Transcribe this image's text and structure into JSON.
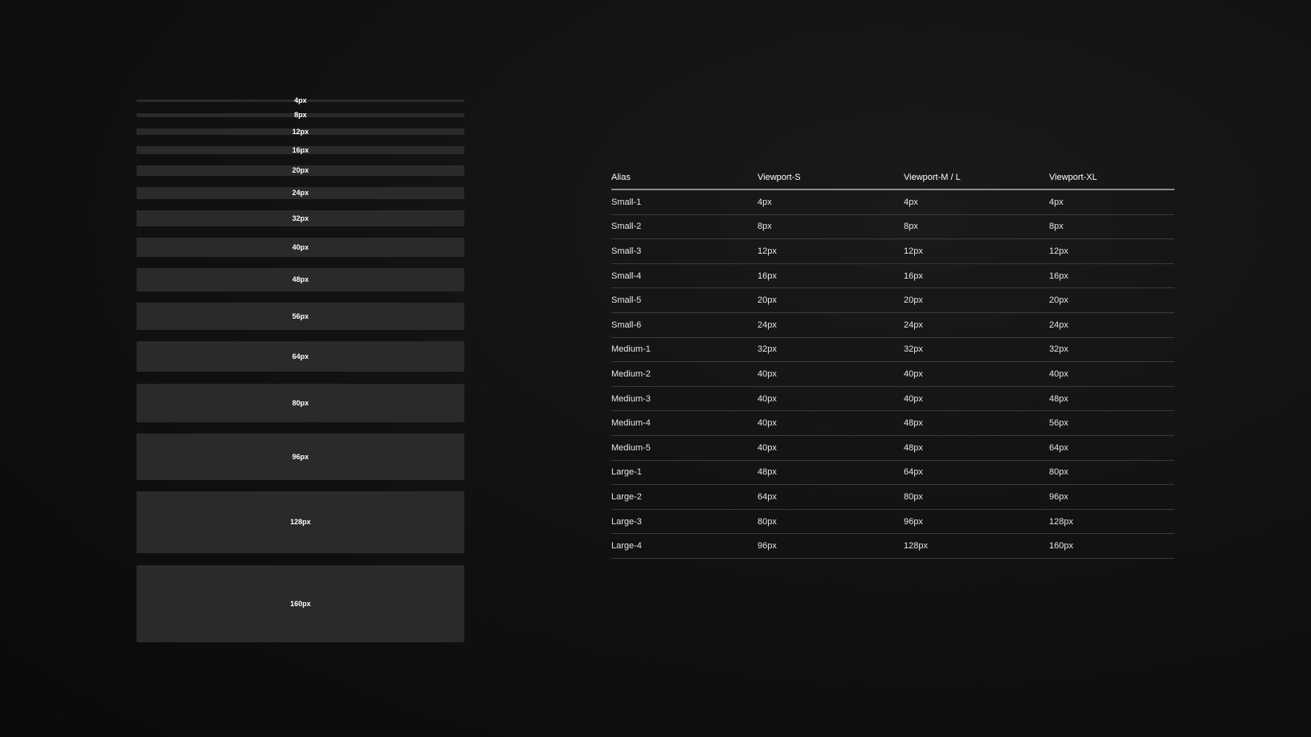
{
  "scale": {
    "labels": [
      "4px",
      "8px",
      "12px",
      "16px",
      "20px",
      "24px",
      "32px",
      "40px",
      "48px",
      "56px",
      "64px",
      "80px",
      "96px",
      "128px",
      "160px"
    ]
  },
  "table": {
    "headers": [
      "Alias",
      "Viewport-S",
      "Viewport-M / L",
      "Viewport-XL"
    ],
    "rows": [
      [
        "Small-1",
        "4px",
        "4px",
        "4px"
      ],
      [
        "Small-2",
        "8px",
        "8px",
        "8px"
      ],
      [
        "Small-3",
        "12px",
        "12px",
        "12px"
      ],
      [
        "Small-4",
        "16px",
        "16px",
        "16px"
      ],
      [
        "Small-5",
        "20px",
        "20px",
        "20px"
      ],
      [
        "Small-6",
        "24px",
        "24px",
        "24px"
      ],
      [
        "Medium-1",
        "32px",
        "32px",
        "32px"
      ],
      [
        "Medium-2",
        "40px",
        "40px",
        "40px"
      ],
      [
        "Medium-3",
        "40px",
        "40px",
        "48px"
      ],
      [
        "Medium-4",
        "40px",
        "48px",
        "56px"
      ],
      [
        "Medium-5",
        "40px",
        "48px",
        "64px"
      ],
      [
        "Large-1",
        "48px",
        "64px",
        "80px"
      ],
      [
        "Large-2",
        "64px",
        "80px",
        "96px"
      ],
      [
        "Large-3",
        "80px",
        "96px",
        "128px"
      ],
      [
        "Large-4",
        "96px",
        "128px",
        "160px"
      ]
    ]
  },
  "colors": {
    "background": "#121212",
    "bar": "#2a2a2a",
    "header_rule": "#8a8a8a",
    "row_rule": "#3a3a3a"
  }
}
